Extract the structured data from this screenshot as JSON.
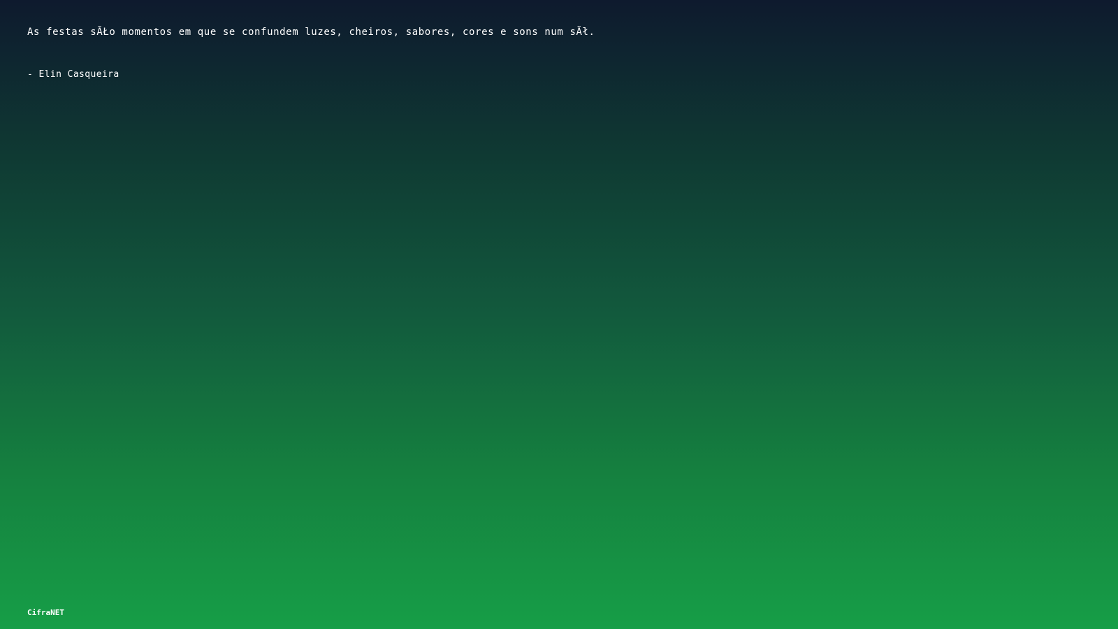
{
  "quote": {
    "text": "As festas sÃŁo momentos em que se confundem luzes, cheiros, sabores, cores e sons num sÃł.",
    "author": "- Elin Casqueira"
  },
  "footer": {
    "brand": "CifraNET"
  },
  "colors": {
    "gradient_top": "#0e1a2e",
    "gradient_bottom": "#169e47",
    "text": "#ffffff"
  }
}
